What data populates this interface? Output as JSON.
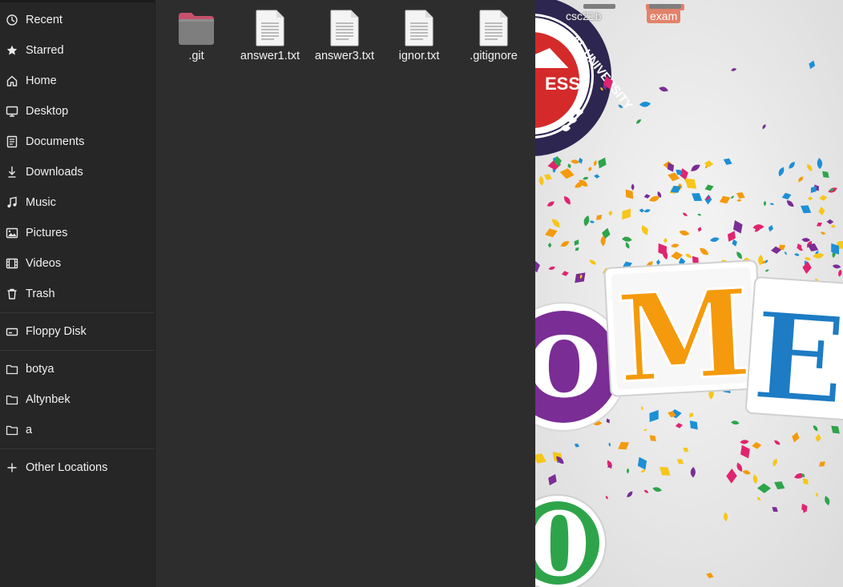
{
  "sidebar": {
    "items": [
      {
        "label": "Recent",
        "icon": "clock-icon"
      },
      {
        "label": "Starred",
        "icon": "star-icon"
      },
      {
        "label": "Home",
        "icon": "home-icon"
      },
      {
        "label": "Desktop",
        "icon": "desktop-icon"
      },
      {
        "label": "Documents",
        "icon": "document-icon"
      },
      {
        "label": "Downloads",
        "icon": "download-icon"
      },
      {
        "label": "Music",
        "icon": "music-icon"
      },
      {
        "label": "Pictures",
        "icon": "picture-icon"
      },
      {
        "label": "Videos",
        "icon": "video-icon"
      },
      {
        "label": "Trash",
        "icon": "trash-icon"
      }
    ],
    "devices": [
      {
        "label": "Floppy Disk",
        "icon": "drive-icon"
      }
    ],
    "bookmarks": [
      {
        "label": "botya",
        "icon": "folder-icon"
      },
      {
        "label": "Altynbek",
        "icon": "folder-icon"
      },
      {
        "label": "a",
        "icon": "folder-icon"
      }
    ],
    "other": {
      "label": "Other Locations",
      "icon": "plus-icon"
    }
  },
  "files": [
    {
      "name": ".git",
      "type": "folder"
    },
    {
      "name": "answer1.txt",
      "type": "text"
    },
    {
      "name": "answer3.txt",
      "type": "text"
    },
    {
      "name": "ignor.txt",
      "type": "text"
    },
    {
      "name": ".gitignore",
      "type": "text"
    }
  ],
  "desktop": {
    "icons": [
      {
        "label": "csc21b",
        "selected": false
      },
      {
        "label": "exam",
        "selected": true
      }
    ],
    "wallpaper_text": {
      "badge_ring_text": "AL UNIVERSITY",
      "badge_center_text": "ESS",
      "letters": [
        "O",
        "M",
        "E"
      ],
      "bottom_digit": "0"
    }
  },
  "colors": {
    "sidebar_bg": "#262626",
    "content_bg": "#2d2d2d",
    "text": "#f0f0f0",
    "folder": "#7e7e7e",
    "folder_tab": "#c7516b",
    "selected_desktop_label": "#e2826a"
  }
}
